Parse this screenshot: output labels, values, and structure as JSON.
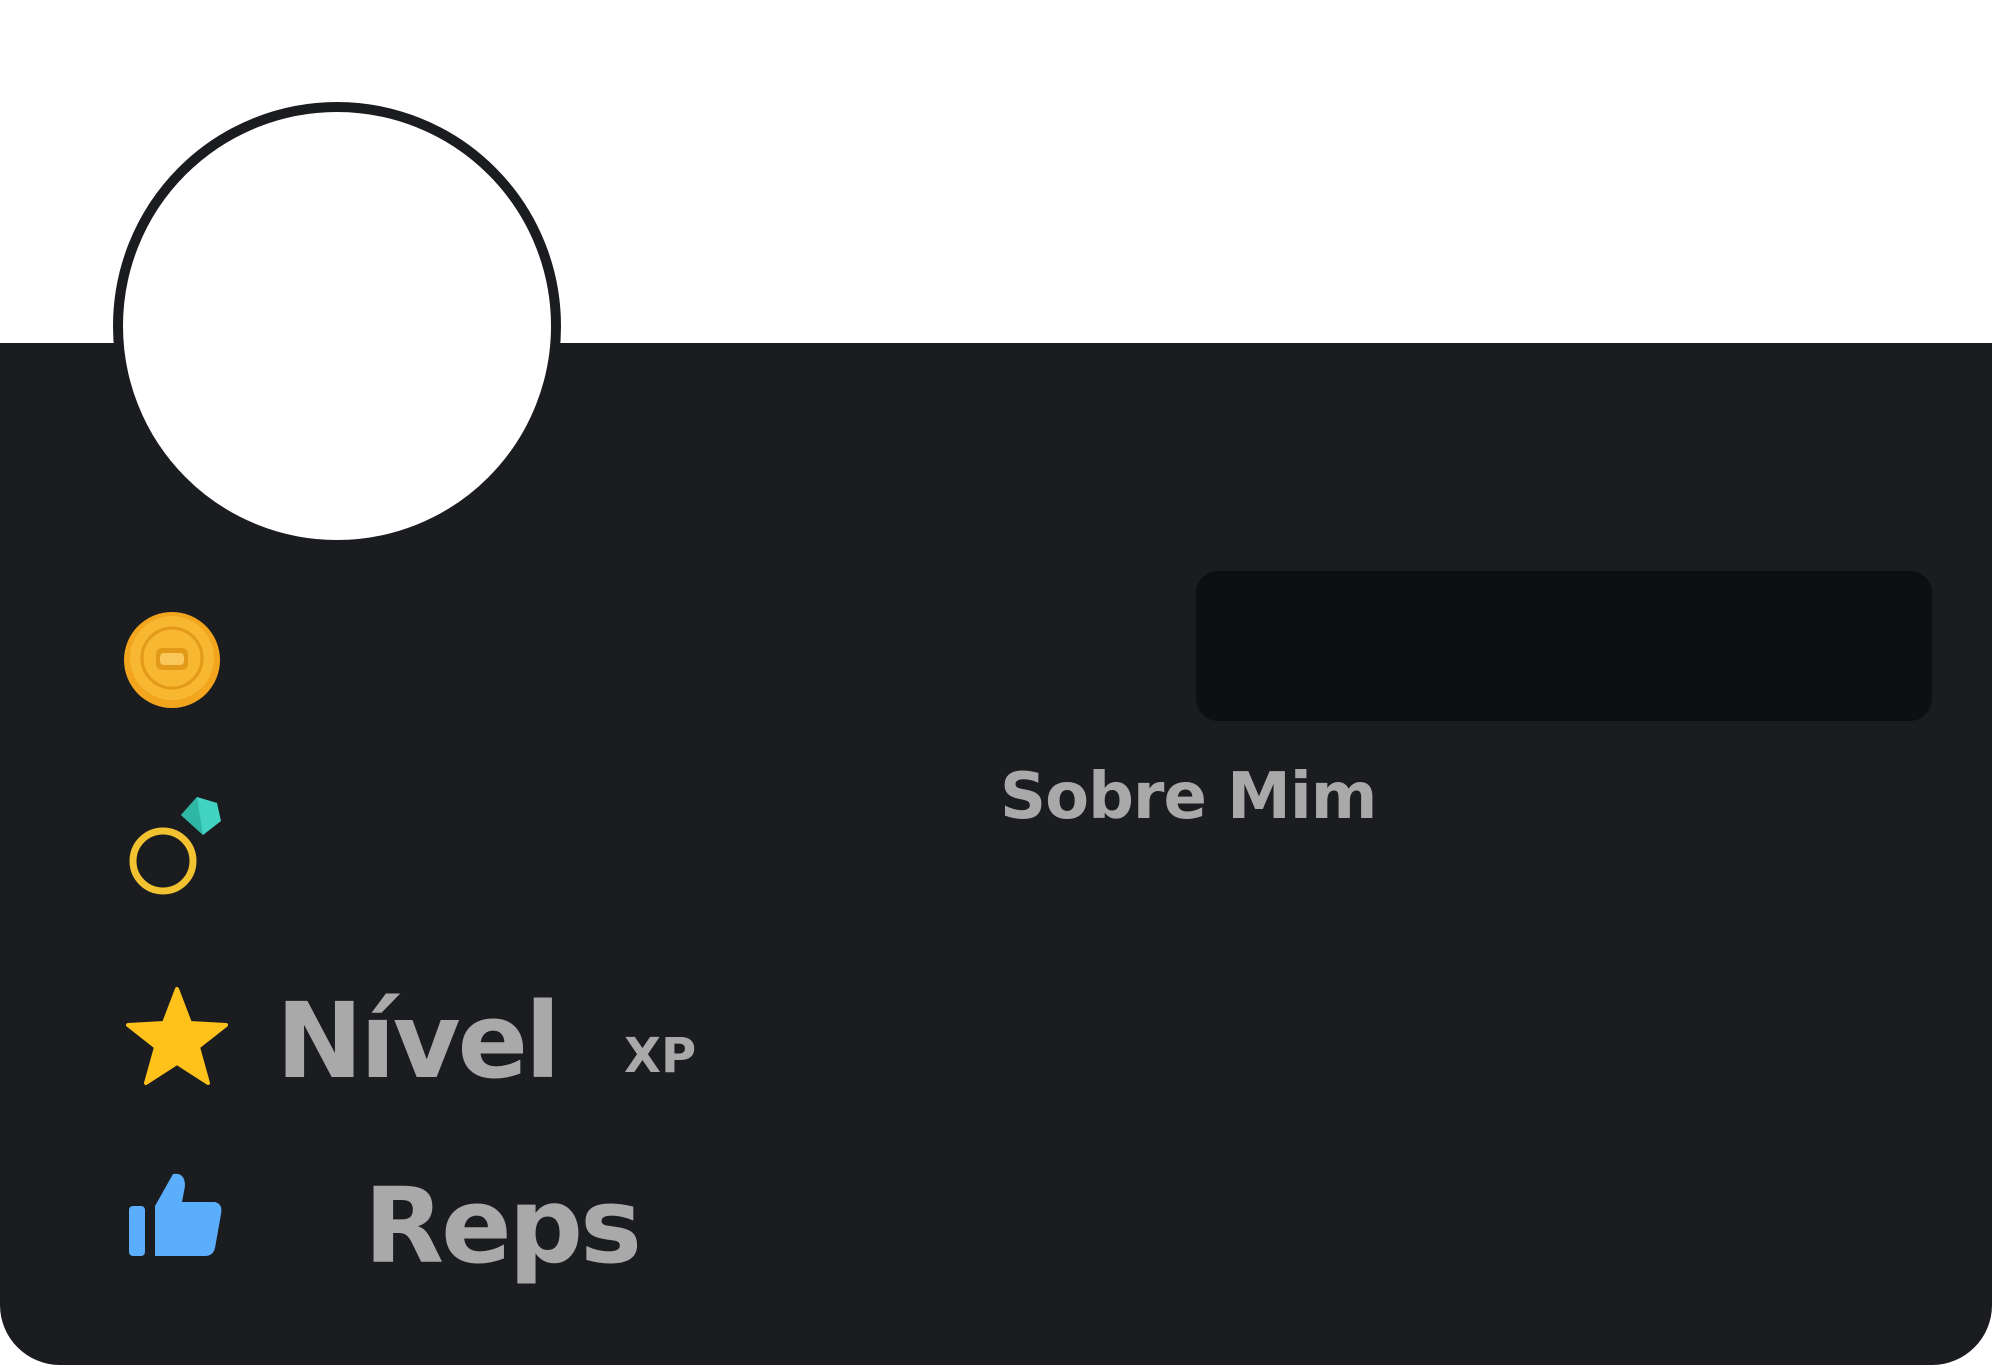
{
  "profile": {
    "about_title": "Sobre Mim",
    "stats": {
      "level_label": "Nível",
      "xp_label": "XP",
      "reps_label": "Reps"
    }
  },
  "icons": {
    "coin": "coin-icon",
    "ring": "diamond-ring-icon",
    "star": "star-icon",
    "reps": "thumbs-up-icon"
  },
  "colors": {
    "card_background": "#1b1c20",
    "about_box": "#0e0f11",
    "label_text": "#a9a9a9",
    "coin": "#f7b731",
    "ring_gold": "#f2c230",
    "ring_gem": "#43d3c2",
    "star": "#ffc21a",
    "thumb": "#5aaefc"
  }
}
